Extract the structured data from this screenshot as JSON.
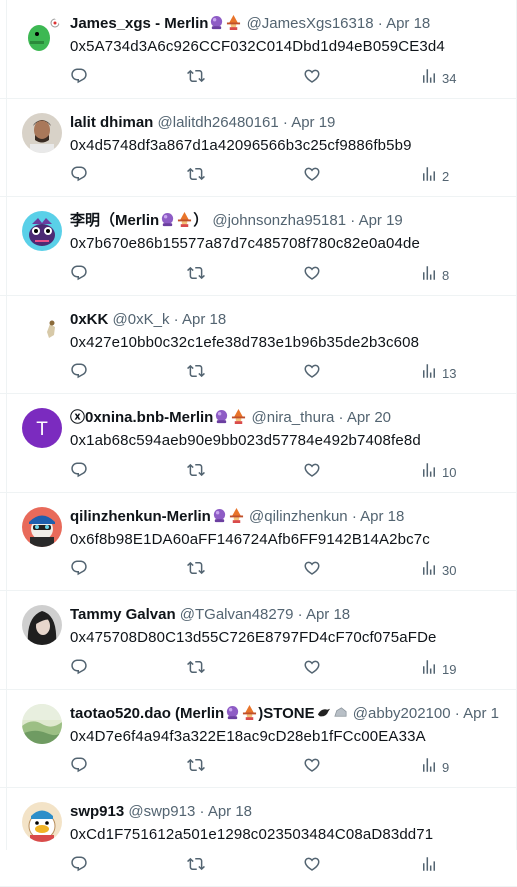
{
  "colors": {
    "text": "#0f1419",
    "muted": "#536471",
    "border": "#eff3f4"
  },
  "tweets": [
    {
      "name": "James_xgs - Merlin",
      "badges": [
        "crystal-ball",
        "wizard"
      ],
      "handle": "@JamesXgs16318",
      "date": "Apr 18",
      "text": "0x5A734d3A6c926CCF032C014Dbd1d94eB059CE3d4",
      "views": "34",
      "avatar": "green-dino"
    },
    {
      "name": "lalit dhiman",
      "badges": [],
      "handle": "@lalitdh26480161",
      "date": "Apr 19",
      "text": "0x4d5748df3a867d1a42096566b3c25cf9886fb5b9",
      "views": "2",
      "avatar": "photo-man"
    },
    {
      "name": "李明（Merlin",
      "name_suffix": "）",
      "badges": [
        "crystal-ball",
        "wizard"
      ],
      "handle": "@johnsonzha95181",
      "date": "Apr 19",
      "text": "0x7b670e86b15577a87d7c485708f780c82e0a04de",
      "views": "8",
      "avatar": "cartoon-purple"
    },
    {
      "name": "0xKK",
      "badges": [],
      "handle": "@0xK_k",
      "date": "Apr 18",
      "text": "0x427e10bb0c32c1efe38d783e1b96b35de2b3c608",
      "views": "13",
      "avatar": "tiny-figure"
    },
    {
      "name": "ⓧ0xnina.bnb-Merlin",
      "badges": [
        "crystal-ball",
        "wizard"
      ],
      "handle": "@nira_thura",
      "date": "Apr 20",
      "text": "0x1ab68c594aeb90e9bb023d57784e492b7408fe8d",
      "views": "10",
      "avatar": "letter-t",
      "avatar_letter": "T"
    },
    {
      "name": "qilinzhenkun-Merlin",
      "badges": [
        "crystal-ball",
        "wizard"
      ],
      "handle": "@qilinzhenkun",
      "date": "Apr 18",
      "text": "0x6f8b98E1DA60aFF146724Afb6FF9142B14A2bc7c",
      "views": "30",
      "avatar": "cartoon-cap"
    },
    {
      "name": "Tammy Galvan",
      "badges": [],
      "handle": "@TGalvan48279",
      "date": "Apr 18",
      "text": "0x475708D80C13d55C726E8797FD4cF70cf075aFDe",
      "views": "19",
      "avatar": "photo-woman"
    },
    {
      "name": "taotao520.dao (Merlin",
      "name_suffix": ")STONE",
      "badges": [
        "crystal-ball",
        "wizard"
      ],
      "suffix_badges": [
        "bird",
        "rock"
      ],
      "handle": "@abby202100",
      "date": "Apr 1",
      "text": "0x4D7e6f4a94f3a322E18ac9cD28eb1fFCc00EA33A",
      "views": "9",
      "avatar": "landscape"
    },
    {
      "name": "swp913",
      "badges": [],
      "handle": "@swp913",
      "date": "Apr 18",
      "text": "0xCd1F751612a501e1298c023503484C08aD83dd71",
      "views": "",
      "avatar": "cartoon-duck"
    }
  ]
}
